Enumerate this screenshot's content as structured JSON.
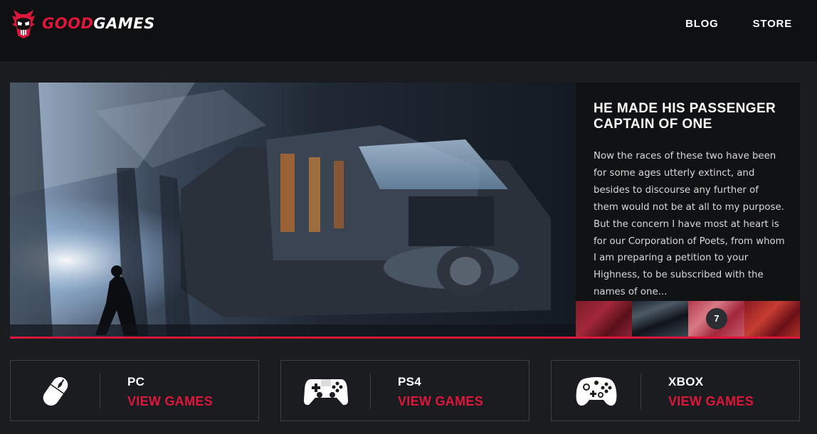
{
  "header": {
    "logo": {
      "part1": "GOOD",
      "part2": "GAMES",
      "icon": "skull-logo-icon"
    },
    "nav": [
      {
        "label": "BLOG"
      },
      {
        "label": "STORE"
      }
    ]
  },
  "hero": {
    "title": "HE MADE HIS PASSENGER CAPTAIN OF ONE",
    "text": "Now the races of these two have been for some ages utterly extinct, and besides to discourse any further of them would not be at all to my purpose. But the concern I have most at heart is for our Corporation of Poets, from whom I am preparing a petition to your Highness, to be subscribed with the names of one...",
    "badge_count": "7"
  },
  "categories": [
    {
      "platform": "PC",
      "link": "VIEW GAMES",
      "icon": "mouse-icon"
    },
    {
      "platform": "PS4",
      "link": "VIEW GAMES",
      "icon": "ps4-gamepad-icon"
    },
    {
      "platform": "XBOX",
      "link": "VIEW GAMES",
      "icon": "xbox-gamepad-icon"
    }
  ],
  "colors": {
    "accent": "#dd163b",
    "header_bg": "#0e1012",
    "page_bg": "#1a1c20"
  }
}
